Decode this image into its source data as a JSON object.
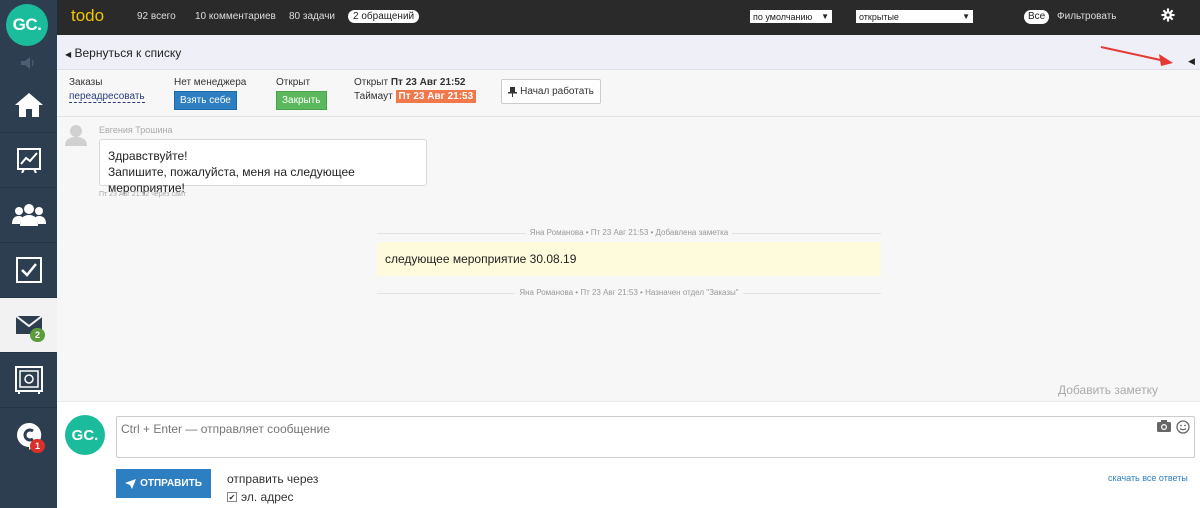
{
  "app": {
    "logo_text": "GC."
  },
  "sidebar": {
    "items": [
      {
        "name": "home",
        "icon": "home-icon"
      },
      {
        "name": "stats",
        "icon": "chart-icon"
      },
      {
        "name": "users",
        "icon": "users-icon"
      },
      {
        "name": "tasks",
        "icon": "checkbox-icon"
      },
      {
        "name": "messages",
        "icon": "envelope-icon",
        "badge": "2",
        "active": true
      },
      {
        "name": "safe",
        "icon": "safe-icon"
      },
      {
        "name": "chat",
        "icon": "chat-logo-icon",
        "badge": "1"
      }
    ]
  },
  "topbar": {
    "title": "todo",
    "total": "92 всего",
    "comments": "10 комментариев",
    "tasks": "80 задачи",
    "requests": "2 обращений",
    "sort_select": "по умолчанию",
    "status_select": "открытые",
    "all_pill": "Все",
    "filter": "Фильтровать"
  },
  "backbar": {
    "back_label": "Вернуться к списку"
  },
  "info": {
    "orders_label": "Заказы",
    "redirect_link": "переадресовать",
    "no_manager_label": "Нет менеджера",
    "take_button": "Взять себе",
    "open_label": "Открыт",
    "close_button": "Закрыть",
    "opened_label": "Открыт",
    "opened_value": "Пт 23 Авг 21:52",
    "timeout_label": "Таймаут",
    "timeout_value": "Пт 23 Авг 21:53",
    "start_button": "Начал работать"
  },
  "feed": {
    "message": {
      "author": "Евгения Трошина",
      "line1": "Здравствуйте!",
      "line2": "Запишите, пожалуйста, меня на следующее мероприятие!",
      "meta": "Пт 23 Авг 21:52 через сайт"
    },
    "system1": "Яна Романова • Пт 23 Авг 21:53 • Добавлена заметка",
    "note": "следующее мероприятие 30.08.19",
    "system2": "Яна Романова • Пт 23 Авг 21:53 • Назначен отдел \"Заказы\"",
    "add_note": "Добавить заметку"
  },
  "composer": {
    "avatar_text": "GC.",
    "placeholder": "Ctrl + Enter — отправляет сообщение",
    "send_button": "ОТПРАВИТЬ",
    "send_via": "отправить через",
    "email_option": "эл. адрес",
    "email_checked": true,
    "download_all": "скачать все ответы"
  },
  "colors": {
    "sidebar_bg": "#2d3e50",
    "brand_teal": "#1bbc9b",
    "topbar_bg": "#2a2a2a",
    "title_yellow": "#f2c500",
    "primary_blue": "#2d7fc1",
    "success_green": "#5cb85c",
    "timeout_orange": "#f0784b",
    "note_yellow": "#fefbdd",
    "annotation_red": "#e53935"
  }
}
